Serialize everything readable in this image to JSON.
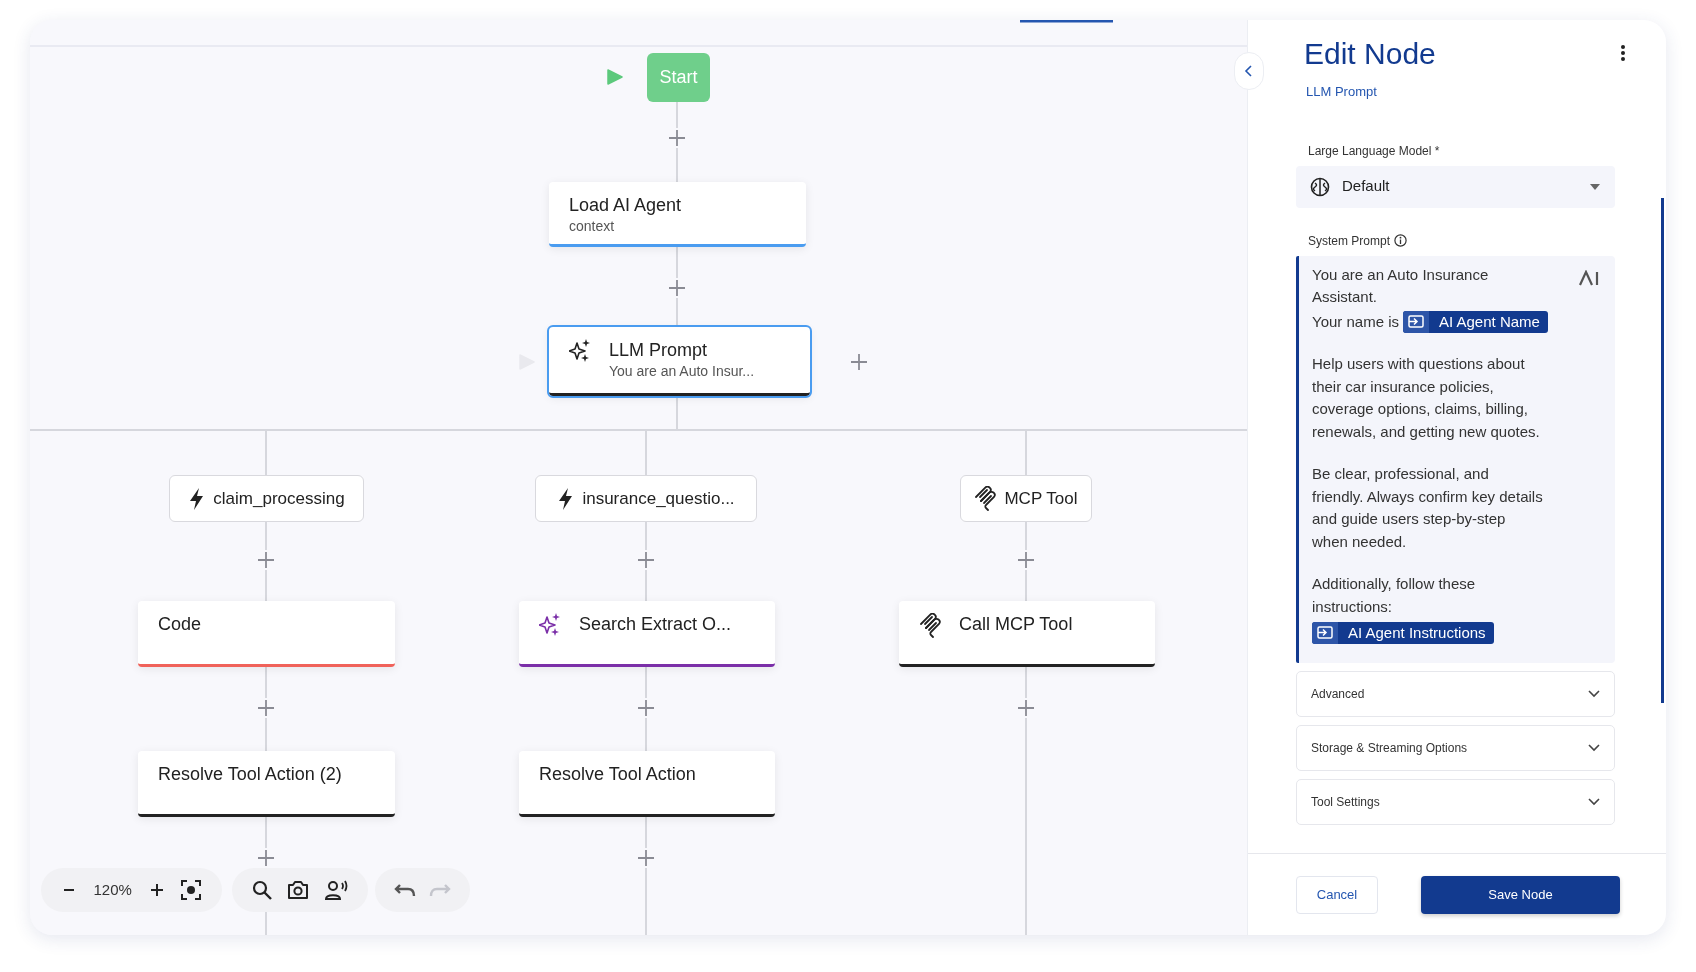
{
  "canvas": {
    "nodes": [
      {
        "kind": "start",
        "title": "Start",
        "selected": false
      },
      {
        "kind": "step",
        "title": "Load AI Agent",
        "subtitle": "context",
        "color": "#4a9cf0",
        "selected": false
      },
      {
        "kind": "ai",
        "title": "LLM Prompt",
        "subtitle": "You are an Auto Insur...",
        "color": "#222222",
        "selected": true
      },
      {
        "kind": "trigger",
        "title": "claim_processing",
        "selected": false
      },
      {
        "kind": "trigger",
        "title": "insurance_questio...",
        "selected": false
      },
      {
        "kind": "mcp_trigger",
        "title": "MCP Tool",
        "selected": false
      },
      {
        "kind": "step",
        "title": "Code",
        "color": "#f0625a",
        "selected": false
      },
      {
        "kind": "ai",
        "title": "Search Extract O...",
        "color": "#7b2fa8",
        "selected": false
      },
      {
        "kind": "mcp",
        "title": "Call MCP Tool",
        "color": "#222222",
        "selected": false
      },
      {
        "kind": "step",
        "title": "Resolve Tool Action (2)",
        "color": "#222222",
        "selected": false
      },
      {
        "kind": "step",
        "title": "Resolve Tool Action",
        "color": "#222222",
        "selected": false
      }
    ],
    "toolbar": {
      "zoom": "120%",
      "undo": {
        "disabled": false
      },
      "redo": {
        "disabled": true
      }
    }
  },
  "panel": {
    "title": "Edit Node",
    "subtitle": "LLM Prompt",
    "model": {
      "label": "Large Language Model *",
      "value": "Default"
    },
    "system_prompt": {
      "label": "System Prompt",
      "paragraphs": [
        [
          {
            "kind": "text",
            "text": "You are an Auto Insurance Assistant."
          },
          {
            "kind": "text_with_variable",
            "text": "Your name is",
            "variable": "AI Agent Name"
          }
        ],
        [
          {
            "kind": "text",
            "text": "Help users with questions about their car insurance policies, coverage options, claims, billing, renewals, and getting new quotes."
          }
        ],
        [
          {
            "kind": "text",
            "text": "Be clear, professional, and friendly. Always confirm key details and guide users step-by-step when needed."
          }
        ],
        [
          {
            "kind": "text",
            "text": "Additionally, follow these instructions:"
          },
          {
            "kind": "variable",
            "variable": "AI Agent Instructions"
          }
        ]
      ]
    },
    "sections": [
      {
        "title": "Advanced",
        "expanded": false
      },
      {
        "title": "Storage & Streaming Options",
        "expanded": false
      },
      {
        "title": "Tool Settings",
        "expanded": false
      }
    ],
    "buttons": {
      "cancel": "Cancel",
      "save": "Save Node"
    }
  }
}
